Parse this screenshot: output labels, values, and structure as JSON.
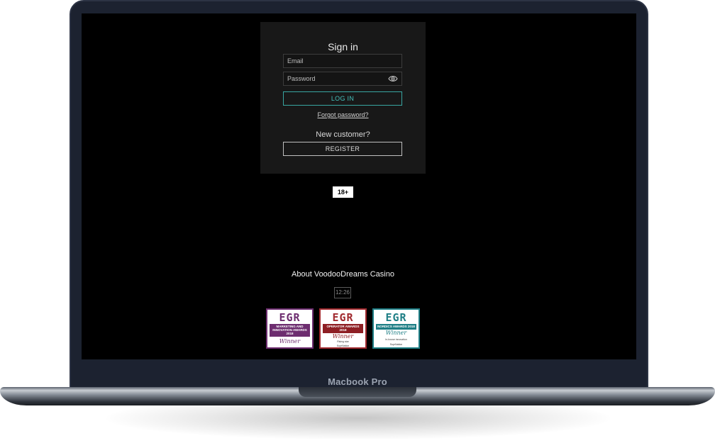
{
  "device": {
    "brand_label": "Macbook Pro"
  },
  "signin": {
    "title": "Sign in",
    "email_placeholder": "Email",
    "password_placeholder": "Password",
    "login_label": "LOG IN",
    "forgot_label": "Forgot password?",
    "new_customer_label": "New customer?",
    "register_label": "REGISTER"
  },
  "footer": {
    "age_badge": "18+",
    "about_label": "About VoodooDreams Casino",
    "clock": "12:26"
  },
  "awards": [
    {
      "logo": "EGR",
      "title": "MARKETING AND INNOVATION AWARDS 2018",
      "result": "Winner"
    },
    {
      "logo": "EGR",
      "title": "OPERATOR AWARDS 2018",
      "result": "Winner",
      "line1": "Rising star",
      "line2": "SuprNation"
    },
    {
      "logo": "EGR",
      "title": "NORDICS AWARDS 2018",
      "result": "Winner",
      "line1": "In-house innovation",
      "line2": "SuprNation"
    }
  ],
  "colors": {
    "accent": "#45c0bb",
    "award_1": "#6d2d6f",
    "award_2": "#a12a2f",
    "award_3": "#1f7f86"
  }
}
